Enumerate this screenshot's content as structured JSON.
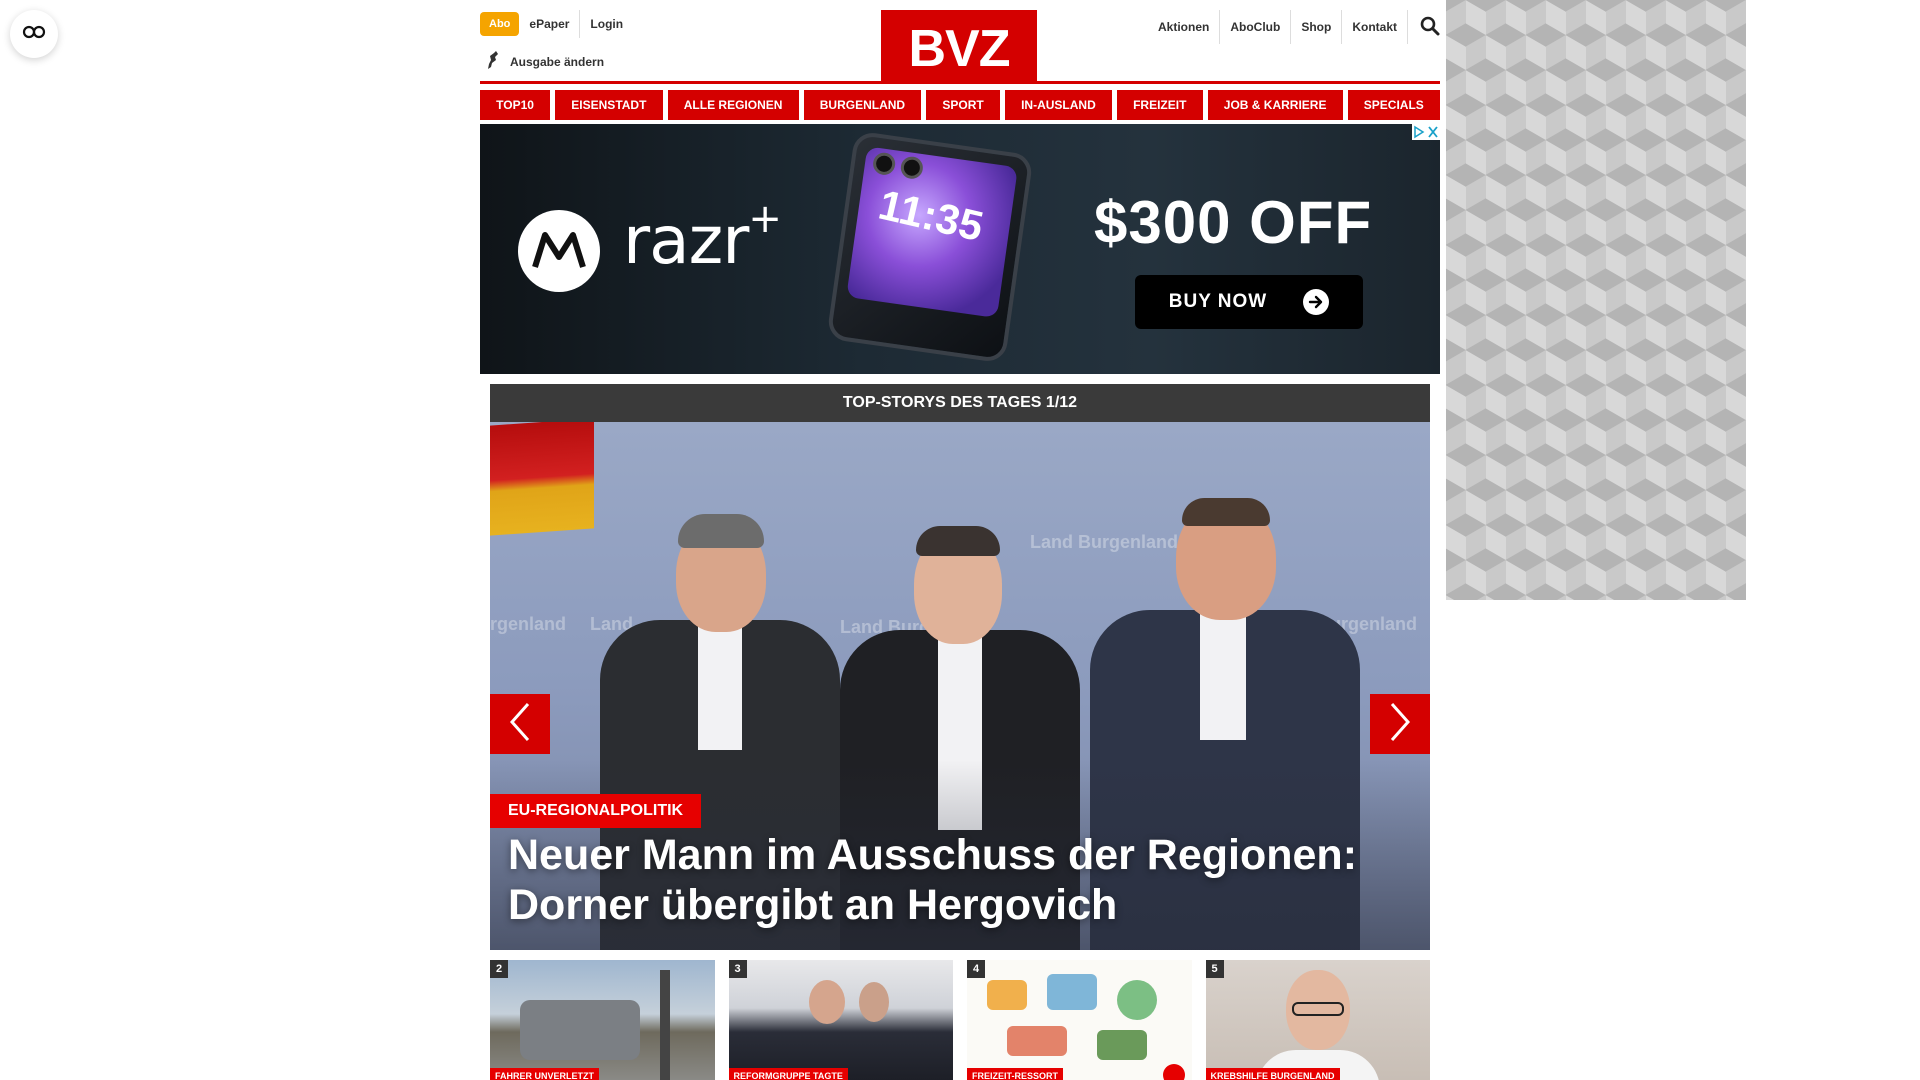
{
  "header": {
    "abo_label": "Abo",
    "epaper_label": "ePaper",
    "login_label": "Login",
    "ausgabe_label": "Ausgabe ändern",
    "logo_text": "BVZ",
    "right_links": [
      "Aktionen",
      "AboClub",
      "Shop",
      "Kontakt"
    ],
    "brand_color": "#d40000"
  },
  "nav": {
    "items": [
      "TOP10",
      "EISENSTADT",
      "ALLE REGIONEN",
      "BURGENLAND",
      "SPORT",
      "IN-AUSLAND",
      "FREIZEIT",
      "JOB & KARRIERE",
      "SPECIALS"
    ]
  },
  "ad": {
    "brand_word": "razr",
    "phone_time": "11:35",
    "offer": "$300 OFF",
    "cta": "BUY NOW"
  },
  "stories": {
    "heading": "TOP-STORYS DES TAGES 1/12",
    "hero": {
      "tag": "EU-REGIONALPOLITIK",
      "title": "Neuer Mann im Ausschuss der Regionen: Dorner übergibt an Hergovich",
      "bg_words": [
        "rgenland",
        "Land",
        "Land Burgenland",
        "nd Burgenland",
        "Land Burgenland"
      ]
    },
    "thumbs": [
      {
        "num": "2",
        "tag": "FAHRER UNVERLETZT"
      },
      {
        "num": "3",
        "tag": "REFORMGRUPPE TAGTE"
      },
      {
        "num": "4",
        "tag": "FREIZEIT-RESSORT"
      },
      {
        "num": "5",
        "tag": "KREBSHILFE BURGENLAND"
      }
    ]
  }
}
